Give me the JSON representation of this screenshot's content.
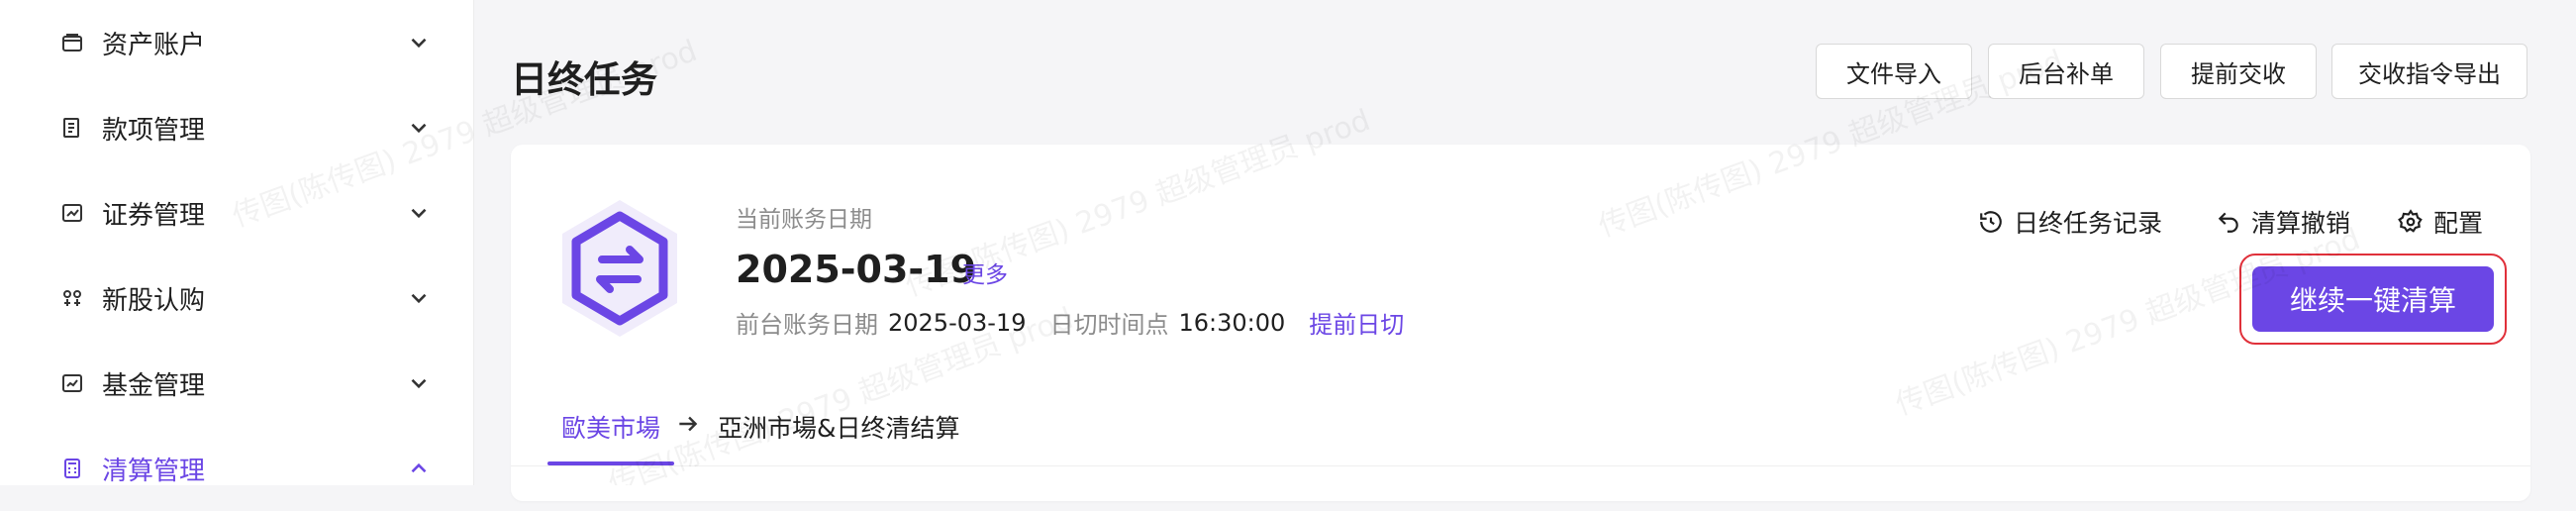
{
  "sidebar": {
    "items": [
      {
        "label": "资产账户",
        "icon": "wallet-icon",
        "state": "collapsed"
      },
      {
        "label": "款项管理",
        "icon": "document-icon",
        "state": "collapsed"
      },
      {
        "label": "证券管理",
        "icon": "stock-chart-icon",
        "state": "collapsed"
      },
      {
        "label": "新股认购",
        "icon": "ipo-icon",
        "state": "collapsed"
      },
      {
        "label": "基金管理",
        "icon": "fund-chart-icon",
        "state": "collapsed"
      },
      {
        "label": "清算管理",
        "icon": "calculator-icon",
        "state": "expanded",
        "active": true
      }
    ]
  },
  "header": {
    "title": "日终任务",
    "buttons": [
      {
        "label": "文件导入"
      },
      {
        "label": "后台补单"
      },
      {
        "label": "提前交收"
      },
      {
        "label": "交收指令导出"
      }
    ]
  },
  "summary": {
    "current_date_label": "当前账务日期",
    "current_date": "2025-03-19",
    "more_link": "更多",
    "front_date_label": "前台账务日期",
    "front_date": "2025-03-19",
    "cutoff_label": "日切时间点",
    "cutoff_time": "16:30:00",
    "advance_link": "提前日切"
  },
  "actions": {
    "records": "日终任务记录",
    "undo": "清算撤销",
    "config": "配置",
    "primary": "继续一键清算"
  },
  "tabs": [
    {
      "label": "歐美市場",
      "active": true
    },
    {
      "label": "亞洲市場&日终清结算",
      "active": false
    }
  ],
  "watermark": "传图(陈传图) 2979 超级管理员 prod",
  "colors": {
    "accent": "#6b46e5",
    "highlight_border": "#e0303a",
    "background": "#f5f5f7"
  }
}
